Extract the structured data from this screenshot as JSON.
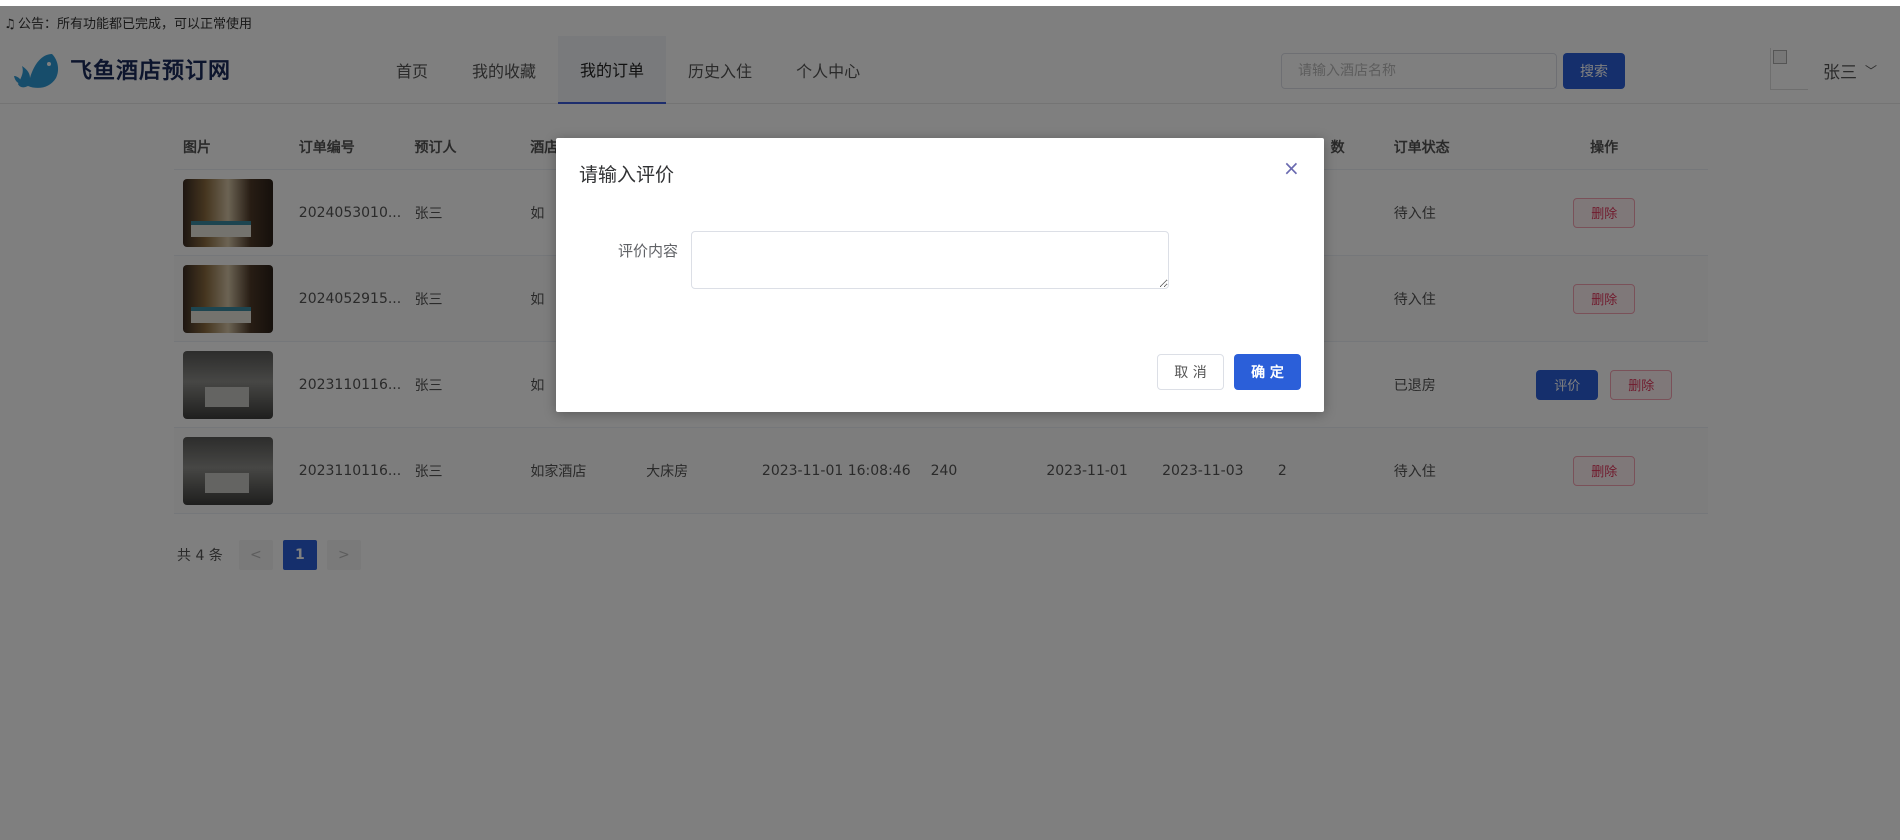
{
  "notice": {
    "text": "公告：所有功能都已完成，可以正常使用"
  },
  "header": {
    "logo_text": "飞鱼酒店预订网",
    "nav": [
      "首页",
      "我的收藏",
      "我的订单",
      "历史入住",
      "个人中心"
    ],
    "active_nav": "我的订单",
    "search_placeholder": "请输入酒店名称",
    "search_button": "搜索",
    "user_name": "张三"
  },
  "table": {
    "headers": [
      "图片",
      "订单编号",
      "预订人",
      "酒店",
      "",
      "",
      "",
      "",
      "",
      "数",
      "订单状态",
      "操作"
    ],
    "rows": [
      {
        "order_no": "2024053010...",
        "booker": "张三",
        "hotel": "如",
        "room": "",
        "time": "",
        "price": "",
        "checkin": "",
        "checkout": "",
        "days": "",
        "status": "待入住",
        "thumb": "room-a",
        "actions": [
          "删除"
        ]
      },
      {
        "order_no": "2024052915...",
        "booker": "张三",
        "hotel": "如",
        "room": "",
        "time": "",
        "price": "",
        "checkin": "",
        "checkout": "",
        "days": "",
        "status": "待入住",
        "thumb": "room-a",
        "actions": [
          "删除"
        ]
      },
      {
        "order_no": "2023110116...",
        "booker": "张三",
        "hotel": "如",
        "room": "",
        "time": "",
        "price": "",
        "checkin": "",
        "checkout": "",
        "days": "",
        "status": "已退房",
        "thumb": "room-b",
        "actions": [
          "评价",
          "删除"
        ]
      },
      {
        "order_no": "2023110116...",
        "booker": "张三",
        "hotel": "如家酒店",
        "room": "大床房",
        "time": "2023-11-01 16:08:46",
        "price": "240",
        "checkin": "2023-11-01",
        "checkout": "2023-11-03",
        "days": "2",
        "status": "待入住",
        "thumb": "room-b",
        "actions": [
          "删除"
        ]
      }
    ]
  },
  "pagination": {
    "total": "共 4 条",
    "current": "1",
    "prev": "<",
    "next": ">"
  },
  "dialog": {
    "title": "请输入评价",
    "field_label": "评价内容",
    "textarea_value": "",
    "cancel": "取 消",
    "confirm": "确 定",
    "close": "×"
  },
  "colors": {
    "primary": "#2b5fd9",
    "danger": "#e0365a",
    "overlay": "rgba(0,0,0,0.5)"
  }
}
